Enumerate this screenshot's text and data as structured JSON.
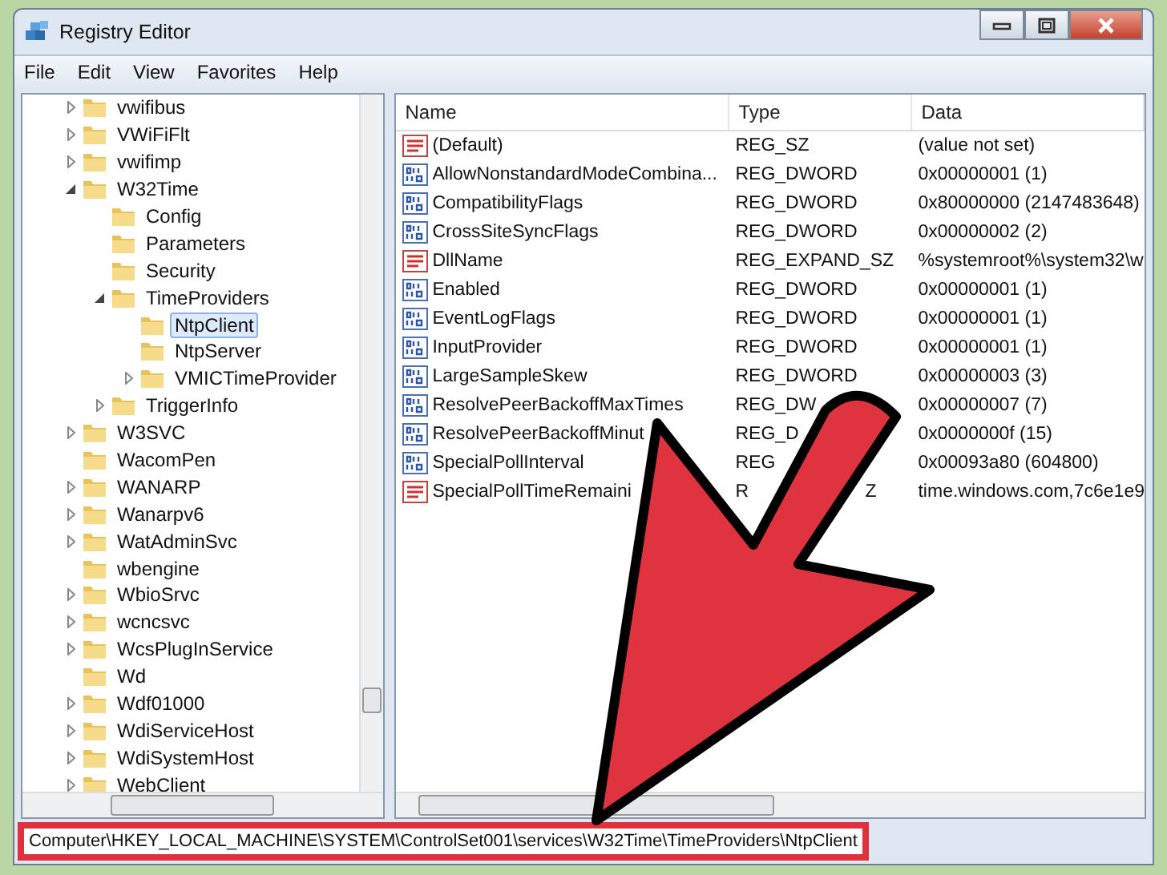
{
  "window": {
    "title": "Registry Editor"
  },
  "menu": [
    "File",
    "Edit",
    "View",
    "Favorites",
    "Help"
  ],
  "tree": [
    {
      "label": "vwifibus",
      "kind": "branch",
      "expanded": false,
      "selected": false
    },
    {
      "label": "VWiFiFlt",
      "kind": "branch",
      "expanded": false,
      "selected": false
    },
    {
      "label": "vwifimp",
      "kind": "branch",
      "expanded": false,
      "selected": false
    },
    {
      "label": "W32Time",
      "kind": "branch",
      "expanded": true,
      "selected": false,
      "children": [
        {
          "label": "Config",
          "kind": "leaf",
          "selected": false
        },
        {
          "label": "Parameters",
          "kind": "leaf",
          "selected": false
        },
        {
          "label": "Security",
          "kind": "leaf",
          "selected": false
        },
        {
          "label": "TimeProviders",
          "kind": "branch",
          "expanded": true,
          "selected": false,
          "children": [
            {
              "label": "NtpClient",
              "kind": "leaf",
              "selected": true
            },
            {
              "label": "NtpServer",
              "kind": "leaf",
              "selected": false
            },
            {
              "label": "VMICTimeProvider",
              "kind": "branch",
              "expanded": false,
              "selected": false
            }
          ]
        },
        {
          "label": "TriggerInfo",
          "kind": "branch",
          "expanded": false,
          "selected": false
        }
      ]
    },
    {
      "label": "W3SVC",
      "kind": "branch",
      "expanded": false,
      "selected": false
    },
    {
      "label": "WacomPen",
      "kind": "leaf",
      "selected": false
    },
    {
      "label": "WANARP",
      "kind": "branch",
      "expanded": false,
      "selected": false
    },
    {
      "label": "Wanarpv6",
      "kind": "branch",
      "expanded": false,
      "selected": false
    },
    {
      "label": "WatAdminSvc",
      "kind": "branch",
      "expanded": false,
      "selected": false
    },
    {
      "label": "wbengine",
      "kind": "leaf",
      "selected": false
    },
    {
      "label": "WbioSrvc",
      "kind": "branch",
      "expanded": false,
      "selected": false
    },
    {
      "label": "wcncsvc",
      "kind": "branch",
      "expanded": false,
      "selected": false
    },
    {
      "label": "WcsPlugInService",
      "kind": "branch",
      "expanded": false,
      "selected": false
    },
    {
      "label": "Wd",
      "kind": "leaf",
      "selected": false
    },
    {
      "label": "Wdf01000",
      "kind": "branch",
      "expanded": false,
      "selected": false
    },
    {
      "label": "WdiServiceHost",
      "kind": "branch",
      "expanded": false,
      "selected": false
    },
    {
      "label": "WdiSystemHost",
      "kind": "branch",
      "expanded": false,
      "selected": false
    },
    {
      "label": "WebClient",
      "kind": "branch",
      "expanded": false,
      "selected": false
    }
  ],
  "table": {
    "columns": [
      "Name",
      "Type",
      "Data"
    ],
    "rows": [
      {
        "kind": "string",
        "name": "(Default)",
        "type": "REG_SZ",
        "data": "(value not set)"
      },
      {
        "kind": "dword",
        "name": "AllowNonstandardModeCombina...",
        "type": "REG_DWORD",
        "data": "0x00000001 (1)"
      },
      {
        "kind": "dword",
        "name": "CompatibilityFlags",
        "type": "REG_DWORD",
        "data": "0x80000000 (2147483648)"
      },
      {
        "kind": "dword",
        "name": "CrossSiteSyncFlags",
        "type": "REG_DWORD",
        "data": "0x00000002 (2)"
      },
      {
        "kind": "string",
        "name": "DllName",
        "type": "REG_EXPAND_SZ",
        "data": "%systemroot%\\system32\\w"
      },
      {
        "kind": "dword",
        "name": "Enabled",
        "type": "REG_DWORD",
        "data": "0x00000001 (1)"
      },
      {
        "kind": "dword",
        "name": "EventLogFlags",
        "type": "REG_DWORD",
        "data": "0x00000001 (1)"
      },
      {
        "kind": "dword",
        "name": "InputProvider",
        "type": "REG_DWORD",
        "data": "0x00000001 (1)"
      },
      {
        "kind": "dword",
        "name": "LargeSampleSkew",
        "type": "REG_DWORD",
        "data": "0x00000003 (3)"
      },
      {
        "kind": "dword",
        "name": "ResolvePeerBackoffMaxTimes",
        "type": "REG_DW",
        "data": "0x00000007 (7)"
      },
      {
        "kind": "dword",
        "name": "ResolvePeerBackoffMinut",
        "type": "REG_D",
        "data": "0x0000000f (15)"
      },
      {
        "kind": "dword",
        "name": "SpecialPollInterval",
        "type": "REG",
        "data": "0x00093a80 (604800)"
      },
      {
        "kind": "string",
        "name": "SpecialPollTimeRemaini",
        "type": "R",
        "type_end": "Z",
        "data": "time.windows.com,7c6e1e9"
      }
    ]
  },
  "status_bar": "Computer\\HKEY_LOCAL_MACHINE\\SYSTEM\\ControlSet001\\services\\W32Time\\TimeProviders\\NtpClient"
}
